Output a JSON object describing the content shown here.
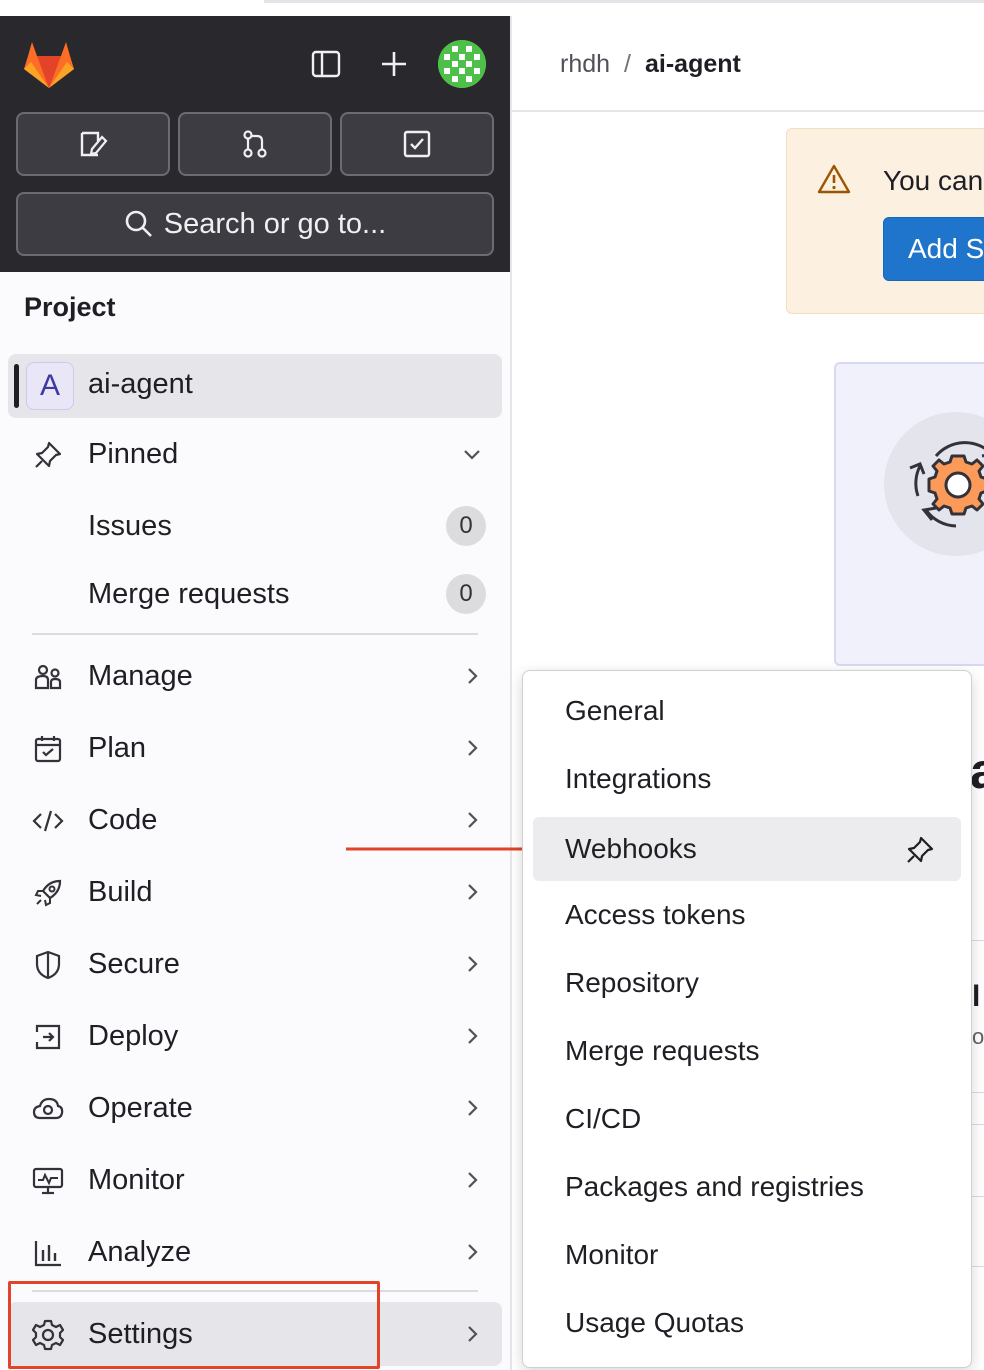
{
  "sidebar": {
    "search_placeholder": "Search or go to...",
    "section_title": "Project",
    "project": {
      "letter": "A",
      "name": "ai-agent"
    },
    "pinned": {
      "label": "Pinned",
      "items": [
        {
          "label": "Issues",
          "count": "0"
        },
        {
          "label": "Merge requests",
          "count": "0"
        }
      ]
    },
    "nav": [
      {
        "label": "Manage",
        "icon": "users-icon"
      },
      {
        "label": "Plan",
        "icon": "calendar-icon"
      },
      {
        "label": "Code",
        "icon": "code-icon"
      },
      {
        "label": "Build",
        "icon": "rocket-icon"
      },
      {
        "label": "Secure",
        "icon": "shield-icon"
      },
      {
        "label": "Deploy",
        "icon": "deploy-icon"
      },
      {
        "label": "Operate",
        "icon": "cloud-gear-icon"
      },
      {
        "label": "Monitor",
        "icon": "monitor-icon"
      },
      {
        "label": "Analyze",
        "icon": "chart-icon"
      },
      {
        "label": "Settings",
        "icon": "gear-icon"
      }
    ]
  },
  "breadcrumb": {
    "parent": "rhdh",
    "separator": "/",
    "current": "ai-agent"
  },
  "alert": {
    "text": "You can",
    "button": "Add S"
  },
  "fragments": {
    "a": "a",
    "b": "l",
    "c": "ol"
  },
  "settings_menu": {
    "items": [
      {
        "label": "General"
      },
      {
        "label": "Integrations"
      },
      {
        "label": "Webhooks",
        "active": true
      },
      {
        "label": "Access tokens"
      },
      {
        "label": "Repository"
      },
      {
        "label": "Merge requests"
      },
      {
        "label": "CI/CD"
      },
      {
        "label": "Packages and registries"
      },
      {
        "label": "Monitor"
      },
      {
        "label": "Usage Quotas"
      }
    ]
  },
  "colors": {
    "annotation_red": "#e24329",
    "sidebar_dark": "#29282d",
    "primary_blue": "#1f75cb",
    "alert_bg": "#fcf1e1"
  }
}
